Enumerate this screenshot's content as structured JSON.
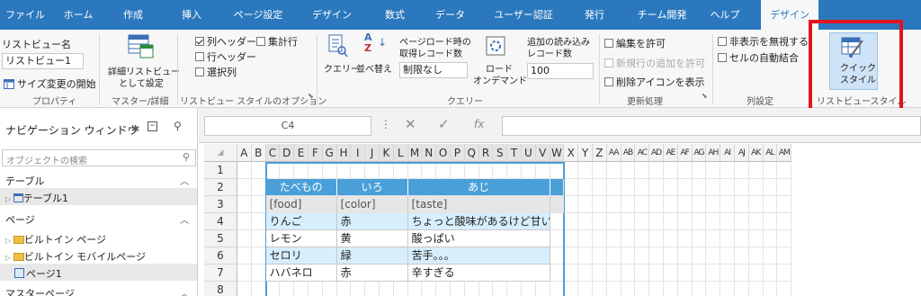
{
  "tabs": [
    "ファイル",
    "ホーム",
    "作成",
    "挿入",
    "ページ設定",
    "デザイン",
    "数式",
    "データ",
    "ユーザー認証",
    "発行",
    "チーム開発",
    "ヘルプ",
    "デザイン"
  ],
  "ribbon": {
    "listview_name_label": "リストビュー名",
    "listview_name_value": "リストビュー1",
    "resize_start": "サイズ変更の開始",
    "group_property": "プロパティ",
    "detail_listview_1": "詳細リストビュー",
    "detail_listview_2": "として設定",
    "group_master": "マスター/詳細",
    "col_header": "列ヘッダー",
    "total_row": "集計行",
    "row_header": "行ヘッダー",
    "select_col": "選択列",
    "group_style_options": "リストビュー スタイルのオプション",
    "query": "クエリー",
    "sort": "並べ替え",
    "page_load_1": "ページロード時の",
    "page_load_2": "取得レコード数",
    "page_load_value": "制限なし",
    "load_on_demand_1": "ロード",
    "load_on_demand_2": "オンデマンド",
    "additional_load_1": "追加の読み込み",
    "additional_load_2": "レコード数",
    "additional_load_value": "100",
    "group_query": "クエリー",
    "allow_edit": "編集を許可",
    "allow_new_row": "新規行の追加を許可",
    "show_delete_icon": "削除アイコンを表示",
    "group_update": "更新処理",
    "ignore_hidden": "非表示を無視する",
    "auto_merge": "セルの自動結合",
    "group_column": "列設定",
    "quick_style_1": "クイック",
    "quick_style_2": "スタイル",
    "group_listview_style": "リストビュースタイル"
  },
  "nav": {
    "title": "ナビゲーション ウィンドウ",
    "search_placeholder": "オブジェクトの検索",
    "sec_table": "テーブル",
    "table1": "テーブル1",
    "sec_page": "ページ",
    "builtin_page": "ビルトイン ページ",
    "builtin_mobile": "ビルトイン モバイルページ",
    "page1": "ページ1",
    "sec_master": "マスターページ"
  },
  "formula": {
    "namebox": "C4",
    "fx": "fx"
  },
  "sheet": {
    "columns": [
      "A",
      "B",
      "C",
      "D",
      "E",
      "F",
      "G",
      "H",
      "I",
      "J",
      "K",
      "L",
      "M",
      "N",
      "O",
      "P",
      "Q",
      "R",
      "S",
      "T",
      "U",
      "V",
      "W",
      "X",
      "Y",
      "Z",
      "AA",
      "AB",
      "AC",
      "AD",
      "AE",
      "AF",
      "AG",
      "AH",
      "AI",
      "AJ",
      "AK",
      "AL",
      "AM"
    ],
    "rows": [
      "1",
      "2",
      "3",
      "4",
      "5",
      "6",
      "7",
      "8"
    ],
    "headers": [
      "たべもの",
      "いろ",
      "あじ"
    ],
    "fields": [
      "[food]",
      "[color]",
      "[taste]"
    ],
    "data": [
      [
        "りんご",
        "赤",
        "ちょっと酸味があるけど甘い"
      ],
      [
        "レモン",
        "黄",
        "酸っぱい"
      ],
      [
        "セロリ",
        "緑",
        "苦手。。。"
      ],
      [
        "ハバネロ",
        "赤",
        "辛すぎる"
      ]
    ]
  },
  "colors": {
    "tab_bar": "#2b78be",
    "header_fill": "#4a9fd8",
    "alt_row": "#d7eefc",
    "highlight": "#e2141d"
  }
}
